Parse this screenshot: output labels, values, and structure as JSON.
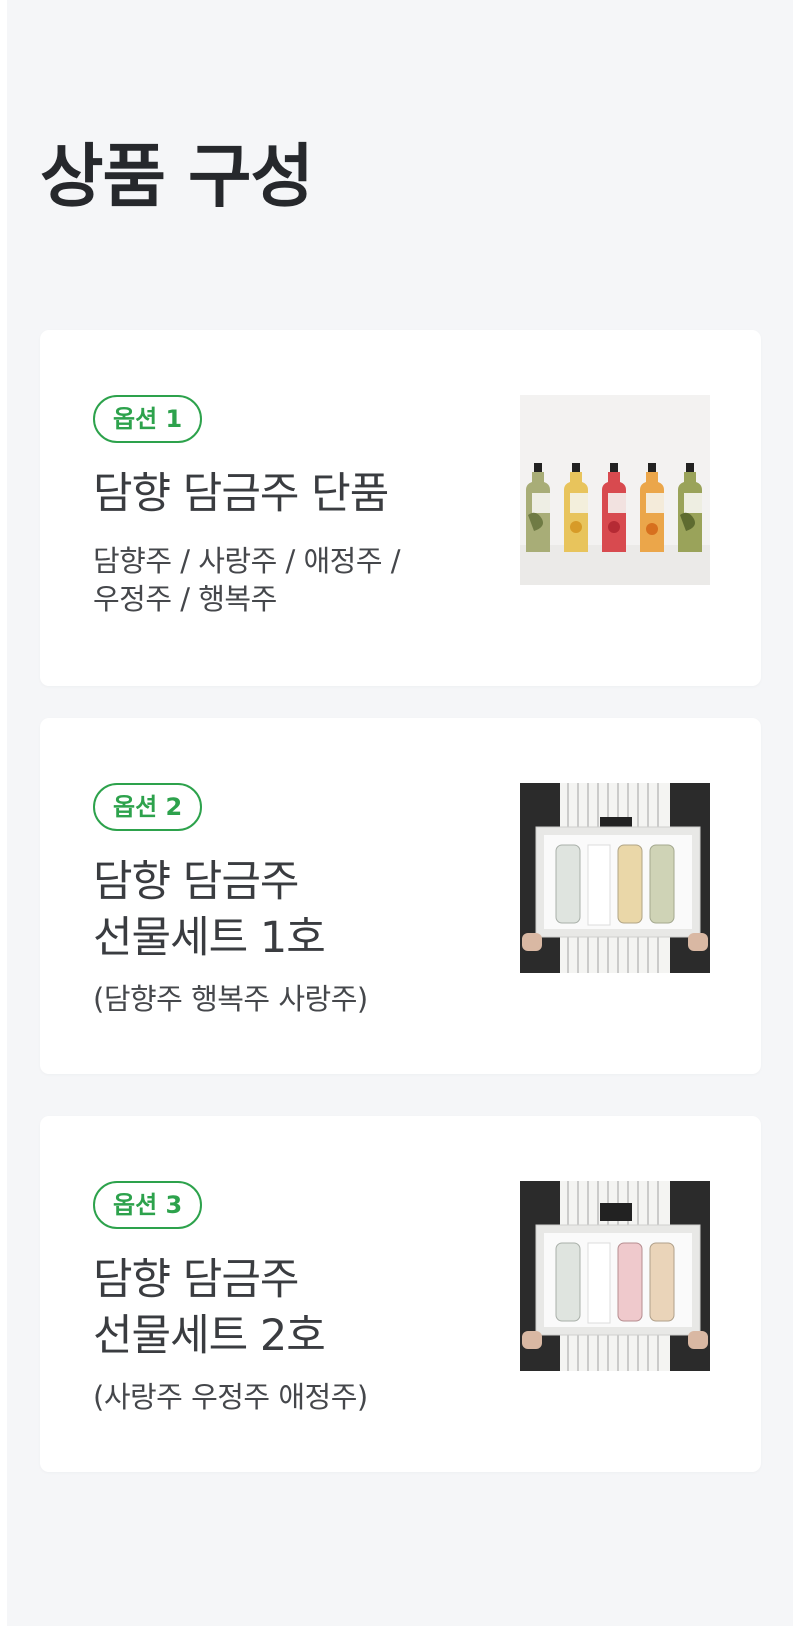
{
  "header": {
    "title": "상품 구성"
  },
  "options": [
    {
      "badge": "옵션 1",
      "title": "담향 담금주 단품",
      "description": "담향주 / 사랑주 / 애정주 /\n우정주 / 행복주",
      "image": "bottles-photo"
    },
    {
      "badge": "옵션 2",
      "title": "담향 담금주\n선물세트 1호",
      "description": "(담향주 행복주 사랑주)",
      "image": "gift-set-photo"
    },
    {
      "badge": "옵션 3",
      "title": "담향 담금주\n선물세트 2호",
      "description": "(사랑주 우정주 애정주)",
      "image": "gift-set-photo"
    }
  ],
  "colors": {
    "accent": "#2da24c",
    "background": "#f5f6f8",
    "card": "#ffffff",
    "title": "#26282c"
  }
}
